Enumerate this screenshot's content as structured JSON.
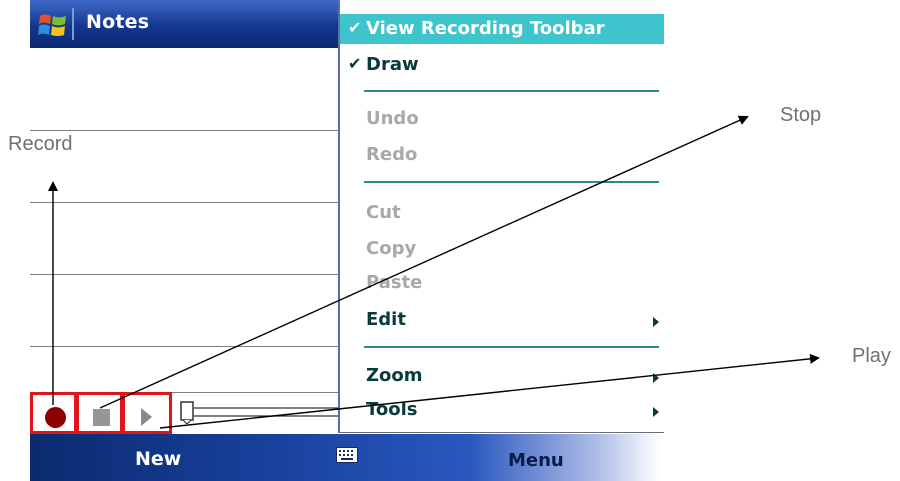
{
  "titlebar": {
    "title": "Notes",
    "logo_icon": "windows-flag-icon"
  },
  "menu": {
    "items": [
      {
        "label": "View Recording Toolbar",
        "checked": true,
        "enabled": true,
        "selected": true
      },
      {
        "label": "Draw",
        "checked": true,
        "enabled": true
      },
      {
        "label": "Undo",
        "enabled": false
      },
      {
        "label": "Redo",
        "enabled": false
      },
      {
        "label": "Cut",
        "enabled": false
      },
      {
        "label": "Copy",
        "enabled": false
      },
      {
        "label": "Paste",
        "enabled": false
      },
      {
        "label": "Edit",
        "enabled": true,
        "submenu": true
      },
      {
        "label": "Zoom",
        "enabled": true,
        "submenu": true
      },
      {
        "label": "Tools",
        "enabled": true,
        "submenu": true
      }
    ],
    "check_glyph": "✔"
  },
  "recording_toolbar": {
    "record_icon": "record-icon",
    "stop_icon": "stop-icon",
    "play_icon": "play-icon",
    "volume_icon": "volume-slider-icon"
  },
  "softkeys": {
    "left": "New",
    "right": "Menu",
    "keyboard_icon": "keyboard-icon"
  },
  "callouts": {
    "record": "Record",
    "stop": "Stop",
    "play": "Play"
  },
  "colors": {
    "menu_highlight": "#3ec4cd",
    "disabled_text": "#a8a8a8",
    "callout_box": "#e0141b",
    "record_red": "#8b0000",
    "titlebar_blue": "#13378f"
  }
}
